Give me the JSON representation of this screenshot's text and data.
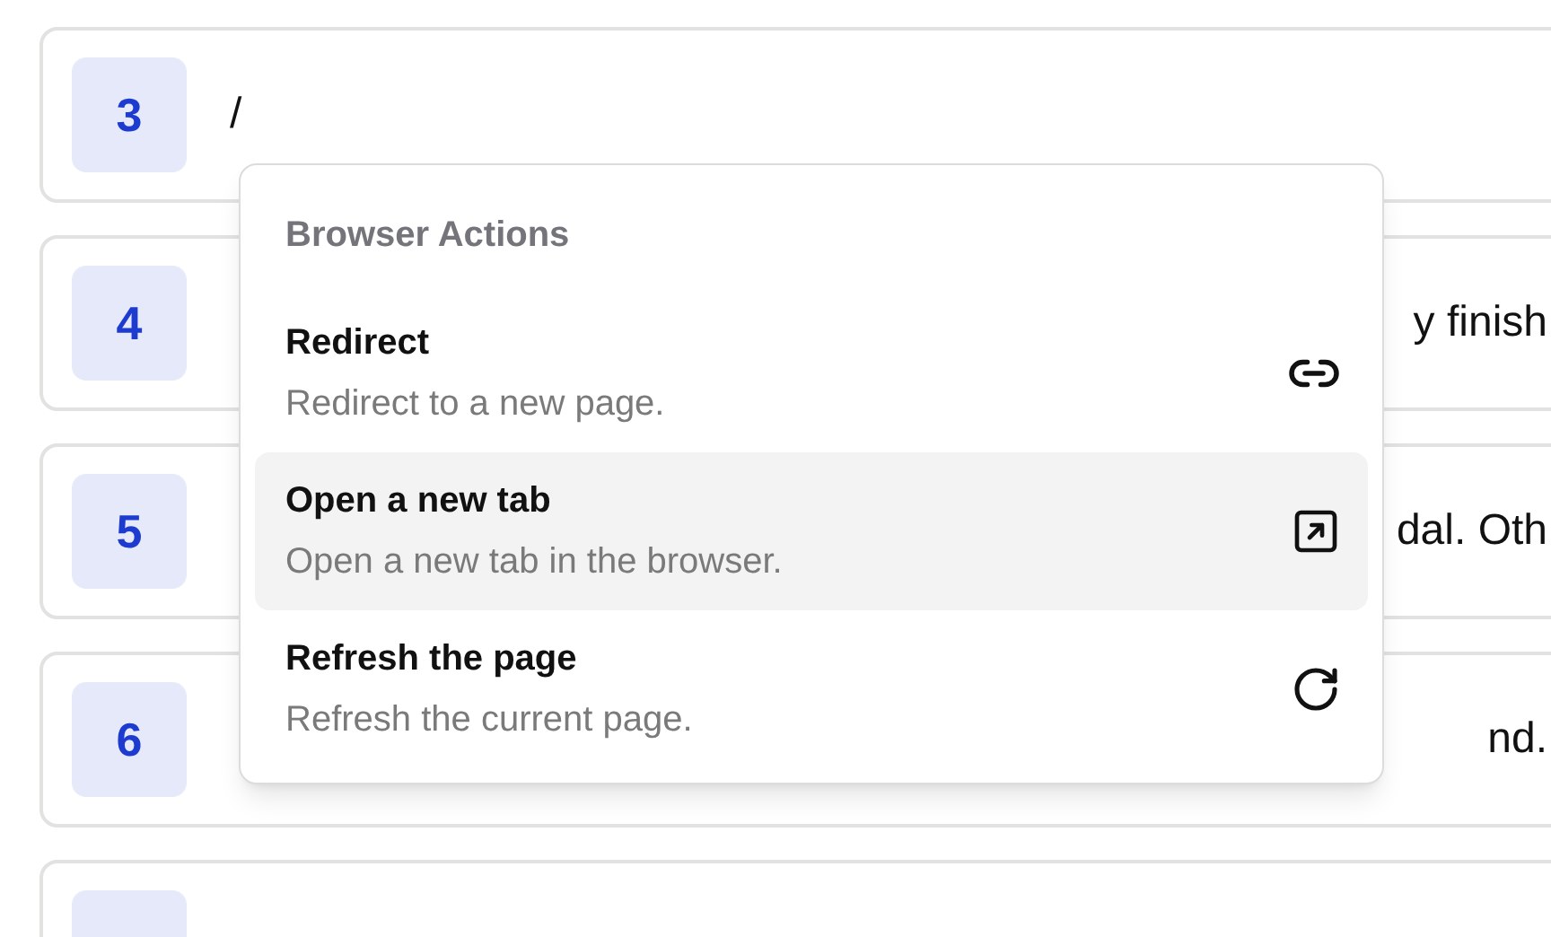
{
  "rows": [
    {
      "number": "3",
      "text_start": "/",
      "text_end": ""
    },
    {
      "number": "4",
      "text_start": "",
      "text_end": "y finish"
    },
    {
      "number": "5",
      "text_start": "",
      "text_end": "dal. Oth"
    },
    {
      "number": "6",
      "text_start": "",
      "text_end": "nd."
    },
    {
      "number": "",
      "text_start": "",
      "text_end": ""
    }
  ],
  "menu": {
    "heading": "Browser Actions",
    "items": [
      {
        "title": "Redirect",
        "description": "Redirect to a new page.",
        "selected": false
      },
      {
        "title": "Open a new tab",
        "description": "Open a new tab in the browser.",
        "selected": true
      },
      {
        "title": "Refresh the page",
        "description": "Refresh the current page.",
        "selected": false
      }
    ]
  }
}
